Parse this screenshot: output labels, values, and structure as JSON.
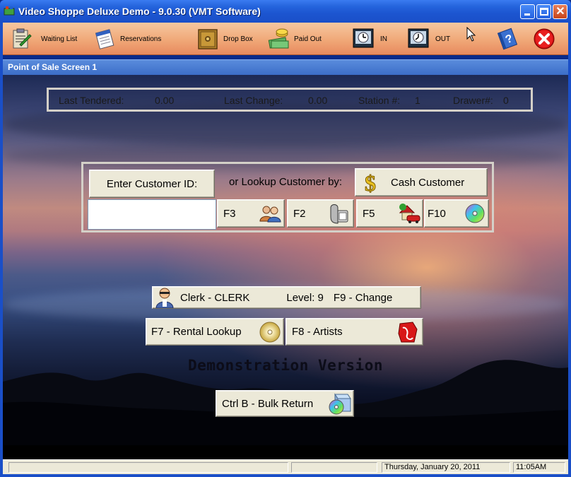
{
  "window": {
    "title": "Video Shoppe Deluxe Demo - 9.0.30 (VMT Software)"
  },
  "toolbar": {
    "waiting_list": "Waiting List",
    "reservations": "Reservations",
    "drop_box": "Drop Box",
    "paid_out": "Paid Out",
    "in": "IN",
    "out": "OUT"
  },
  "panel": {
    "title": "Point of Sale Screen 1"
  },
  "info": {
    "last_tendered_label": "Last Tendered:",
    "last_tendered_value": "0.00",
    "last_change_label": "Last Change:",
    "last_change_value": "0.00",
    "station_label": "Station #:",
    "station_value": "1",
    "drawer_label": "Drawer#:",
    "drawer_value": "0"
  },
  "lookup": {
    "enter_id_label": "Enter Customer ID:",
    "lookup_by_label": "or Lookup Customer by:",
    "cash_customer": "Cash Customer",
    "customer_id_value": "",
    "f3": "F3",
    "f2": "F2",
    "f5": "F5",
    "f10": "F10"
  },
  "clerk": {
    "name": "Clerk - CLERK",
    "level": "Level: 9",
    "change": "F9 - Change"
  },
  "actions": {
    "rental_lookup": "F7 - Rental Lookup",
    "artists": "F8 - Artists",
    "bulk_return": "Ctrl B - Bulk Return"
  },
  "demo_notice": "Demonstration Version",
  "status": {
    "date": "Thursday, January 20, 2011",
    "time": "11:05AM"
  },
  "icons": {
    "waiting_list": "clipboard-icon",
    "reservations": "notepad-icon",
    "drop_box": "safe-icon",
    "paid_out": "money-icon",
    "in": "clock-in-icon",
    "out": "clock-out-icon",
    "help": "help-book-icon",
    "exit": "exit-icon"
  },
  "colors": {
    "title_bar": "#2463dc",
    "toolbar": "#f0a878",
    "panel_header": "#3c6ec8",
    "exit_red": "#d01010"
  }
}
